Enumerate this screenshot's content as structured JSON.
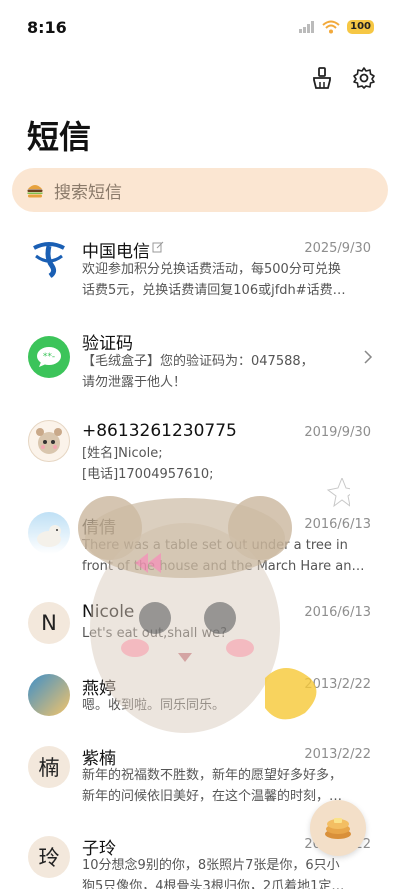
{
  "status": {
    "time": "8:16",
    "battery": "100"
  },
  "header": {
    "title": "短信"
  },
  "search": {
    "placeholder": "搜索短信"
  },
  "messages": [
    {
      "sender": "中国电信",
      "date": "2025/9/30",
      "line1": "欢迎参加积分兑换话费活动，每500分可兑换",
      "line2": "话费5元，兑换话费请回复106或jfdh#话费…"
    },
    {
      "sender": "验证码",
      "date": "",
      "line1": "【毛绒盒子】您的验证码为：047588，",
      "line2": "请勿泄露于他人！"
    },
    {
      "sender": "+8613261230775",
      "date": "2019/9/30",
      "line1": "[姓名]Nicole;",
      "line2": "[电话]17004957610;"
    },
    {
      "sender": "倩倩",
      "date": "2016/6/13",
      "line1": "There was a table set out under a tree in",
      "line2": "front of the house and the March Hare an…"
    },
    {
      "sender": "Nicole",
      "avatar_letter": "N",
      "date": "2016/6/13",
      "line1": "Let's eat out,shall we?",
      "line2": ""
    },
    {
      "sender": "燕婷",
      "date": "2013/2/22",
      "line1": "嗯。收到啦。同乐同乐。",
      "line2": ""
    },
    {
      "sender": "紫楠",
      "avatar_letter": "楠",
      "date": "2013/2/22",
      "line1": "新年的祝福数不胜数，新年的愿望好多好多，",
      "line2": "新年的问候依旧美好，在这个温馨的时刻，…"
    },
    {
      "sender": "子玲",
      "avatar_letter": "玲",
      "date": "2013/2/22",
      "line1": "10分想念9别的你，8张照片7张是你，6只小",
      "line2": "狗5只像你，4根骨头3根归你，2爪着地1定…"
    }
  ],
  "colors": {
    "search_bg": "#fbe6d2",
    "telecom_blue": "#1a5fb4",
    "sms_green": "#3cc45a",
    "fab_bg": "#f3dfc8"
  }
}
